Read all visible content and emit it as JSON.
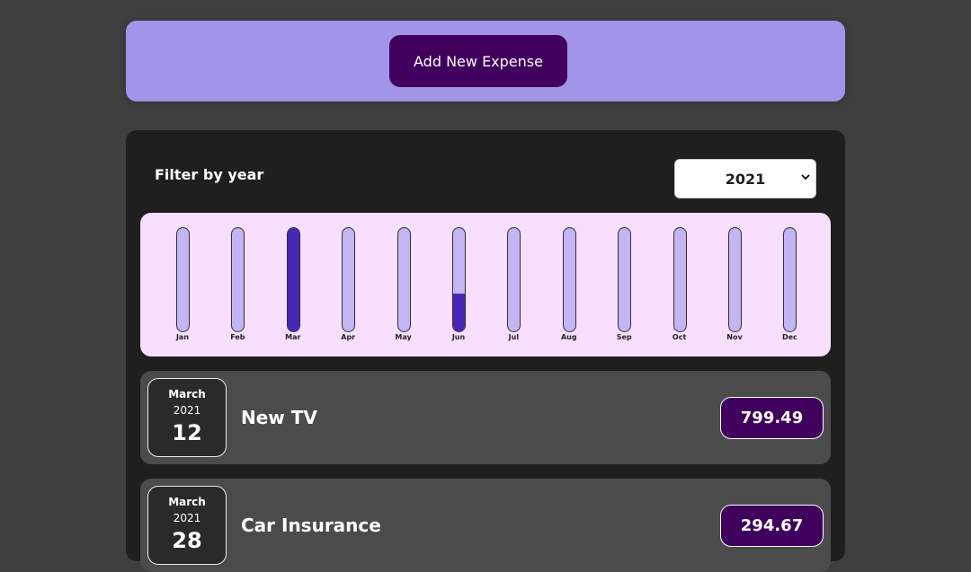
{
  "new_expense": {
    "add_button_label": "Add New Expense"
  },
  "filter": {
    "label": "Filter by year",
    "selected_year": "2021"
  },
  "chart_data": {
    "type": "bar",
    "categories": [
      "Jan",
      "Feb",
      "Mar",
      "Apr",
      "May",
      "Jun",
      "Jul",
      "Aug",
      "Sep",
      "Oct",
      "Nov",
      "Dec"
    ],
    "values": [
      0,
      0,
      799.49,
      0,
      0,
      294.67,
      0,
      0,
      0,
      0,
      0,
      0
    ],
    "max": 799.49
  },
  "expenses": [
    {
      "month": "March",
      "year": "2021",
      "day": "12",
      "title": "New TV",
      "amount": "799.49"
    },
    {
      "month": "March",
      "year": "2021",
      "day": "28",
      "title": "Car Insurance",
      "amount": "294.67"
    }
  ],
  "colors": {
    "page_bg": "#3f3f3f",
    "new_expense_bg": "#a195ea",
    "button_bg": "#40005d",
    "card_bg": "#1f1f1f",
    "chart_bg": "#f8dfff",
    "bar_track": "#c3b4f3",
    "bar_fill": "#4826b9",
    "item_bg": "#4b4b4b"
  }
}
